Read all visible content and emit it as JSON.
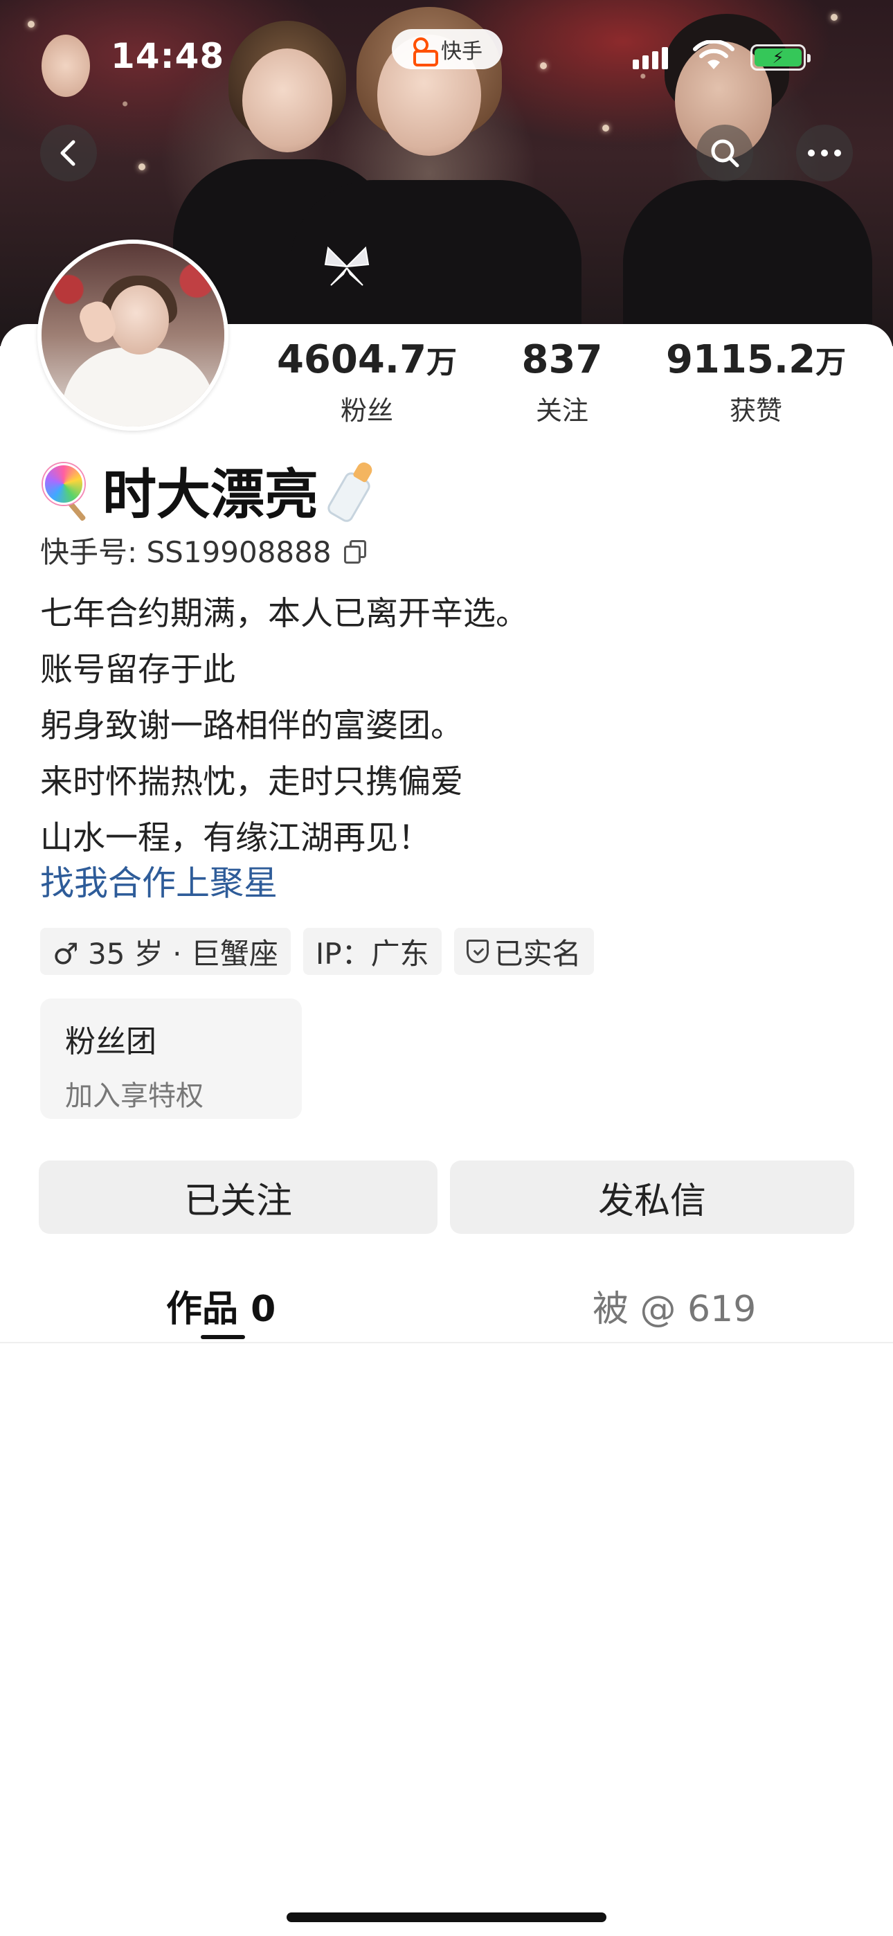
{
  "status_bar": {
    "time": "14:48",
    "app_name": "快手",
    "battery_color": "#35c759"
  },
  "header": {
    "back_icon": "chevron-left-icon",
    "search_icon": "search-icon",
    "more_icon": "more-dots-icon"
  },
  "profile": {
    "stats": [
      {
        "number": "4604.7",
        "unit": "万",
        "label": "粉丝"
      },
      {
        "number": "837",
        "unit": "",
        "label": "关注"
      },
      {
        "number": "9115.2",
        "unit": "万",
        "label": "获赞"
      }
    ],
    "name": "时大漂亮",
    "name_prefix_icon": "lollipop-emoji",
    "name_suffix_icon": "baby-bottle-emoji",
    "kuaishou_id": "快手号: SS19908888",
    "bio_lines": [
      "七年合约期满，本人已离开辛选。",
      "账号留存于此",
      "躬身致谢一路相伴的富婆团。",
      "来时怀揣热忱，走时只携偏爱",
      "山水一程，有缘江湖再见！"
    ],
    "bio_link": "找我合作上聚星",
    "link_color": "#2e5c99",
    "tags": {
      "age": "♂ 35 岁 · 巨蟹座",
      "ip": "IP：广东",
      "verified": "已实名"
    },
    "fan_club": {
      "title": "粉丝团",
      "subtitle": "加入享特权"
    }
  },
  "actions": {
    "follow": "已关注",
    "message": "发私信"
  },
  "tabs": [
    {
      "label": "作品 0",
      "active": true
    },
    {
      "label": "被 @ 619",
      "active": false
    }
  ]
}
